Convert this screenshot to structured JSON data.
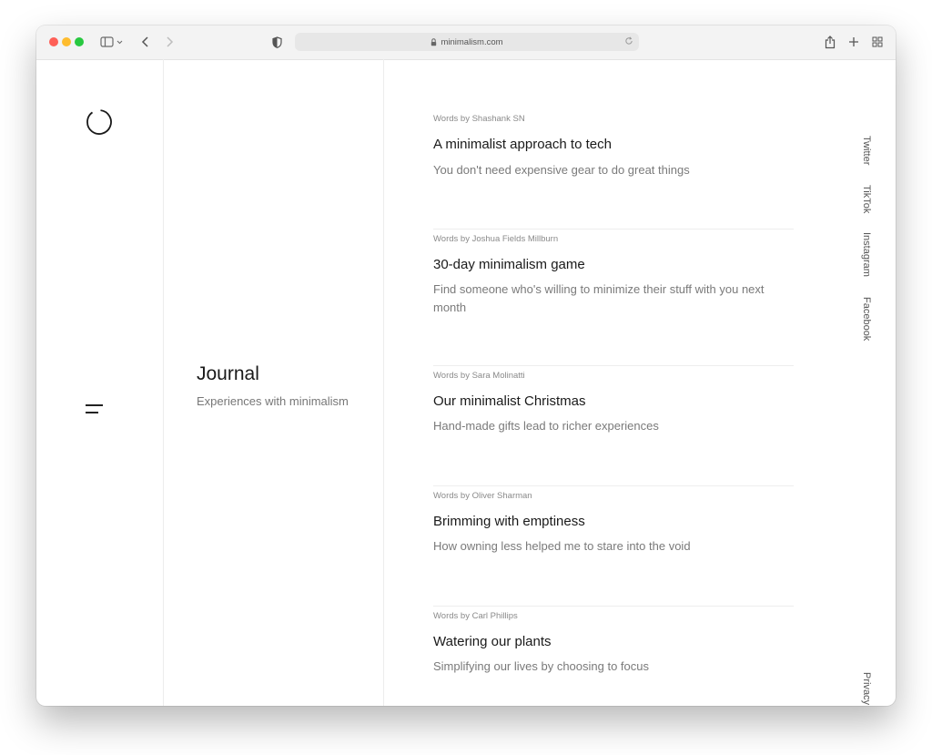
{
  "browser": {
    "url": "minimalism.com"
  },
  "sidebar": {
    "logo_icon": "circle-logo-icon",
    "menu_icon": "hamburger-menu-icon"
  },
  "section": {
    "title": "Journal",
    "subtitle": "Experiences with minimalism"
  },
  "articles": [
    {
      "author": "Words by Shashank SN",
      "title": "A minimalist approach to tech",
      "description": "You don't need expensive gear to do great things"
    },
    {
      "author": "Words by Joshua Fields Millburn",
      "title": "30-day minimalism game",
      "description": "Find someone who's willing to minimize their stuff with you next month"
    },
    {
      "author": "Words by Sara Molinatti",
      "title": "Our minimalist Christmas",
      "description": "Hand-made gifts lead to richer experiences"
    },
    {
      "author": "Words by Oliver Sharman",
      "title": "Brimming with emptiness",
      "description": "How owning less helped me to stare into the void"
    },
    {
      "author": "Words by Carl Phillips",
      "title": "Watering our plants",
      "description": "Simplifying our lives by choosing to focus"
    }
  ],
  "social_links": [
    "Twitter",
    "TikTok",
    "Instagram",
    "Facebook"
  ],
  "footer": {
    "privacy": "Privacy"
  },
  "colors": {
    "accent_red": "#fe5f57",
    "accent_yellow": "#febc2e",
    "accent_green": "#28c840"
  }
}
